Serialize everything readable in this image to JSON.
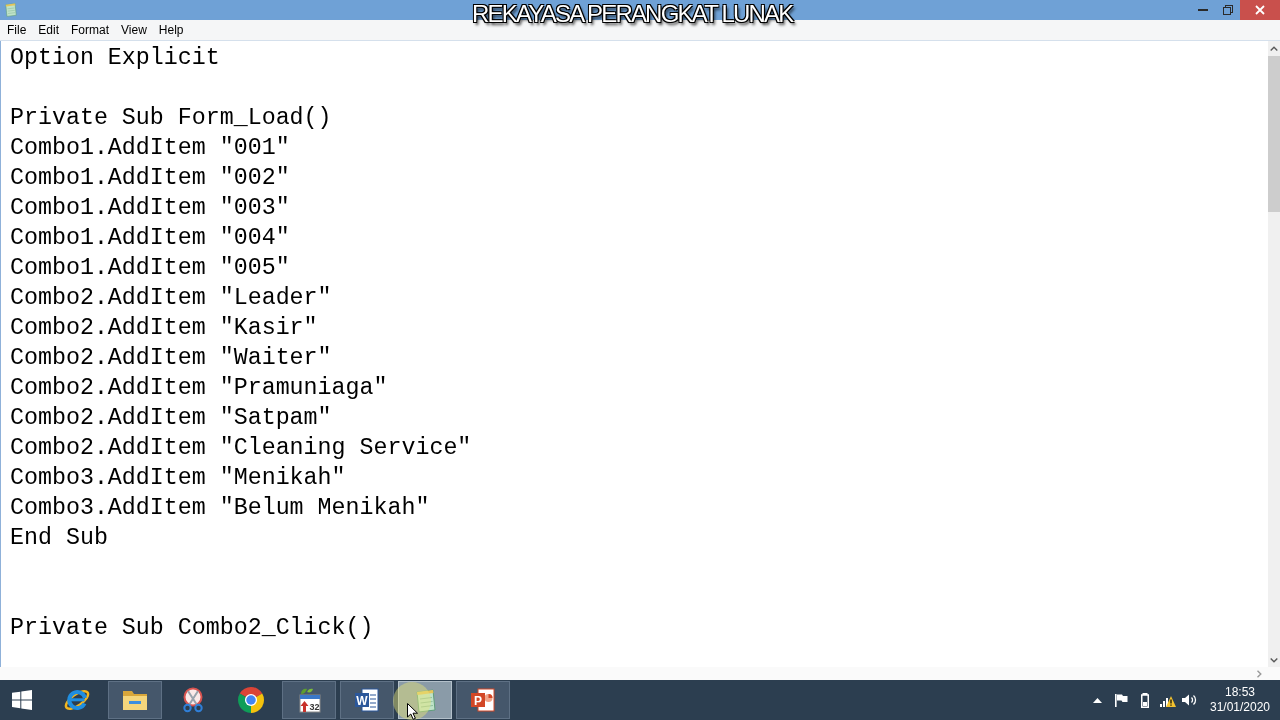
{
  "caption": "REKAYASA PERANGKAT LUNAK",
  "menu": [
    "File",
    "Edit",
    "Format",
    "View",
    "Help"
  ],
  "editor": {
    "lines": [
      {
        "kind": "code",
        "text": "Option Explicit"
      },
      {
        "kind": "blank"
      },
      {
        "kind": "code",
        "text": "Private Sub Form_Load()"
      },
      {
        "kind": "code",
        "text": "Combo1.AddItem \"001\""
      },
      {
        "kind": "code",
        "text": "Combo1.AddItem \"002\""
      },
      {
        "kind": "code",
        "text": "Combo1.AddItem \"003\""
      },
      {
        "kind": "code",
        "text": "Combo1.AddItem \"004\""
      },
      {
        "kind": "code",
        "text": "Combo1.AddItem \"005\""
      },
      {
        "kind": "code",
        "text": "Combo2.AddItem \"Leader\""
      },
      {
        "kind": "code",
        "text": "Combo2.AddItem \"Kasir\""
      },
      {
        "kind": "code",
        "text": "Combo2.AddItem \"Waiter\""
      },
      {
        "kind": "code",
        "text": "Combo2.AddItem \"Pramuniaga\""
      },
      {
        "kind": "code",
        "text": "Combo2.AddItem \"Satpam\""
      },
      {
        "kind": "code",
        "text": "Combo2.AddItem \"Cleaning Service\""
      },
      {
        "kind": "code",
        "text": "Combo3.AddItem \"Menikah\""
      },
      {
        "kind": "code",
        "text": "Combo3.AddItem \"Belum Menikah\""
      },
      {
        "kind": "code",
        "text": "End Sub"
      },
      {
        "kind": "blank"
      },
      {
        "kind": "blank"
      },
      {
        "kind": "code",
        "text": "Private Sub Combo2_Click()"
      }
    ]
  },
  "taskbar": {
    "buttons": [
      {
        "kind": "start",
        "running": false,
        "selected": false
      },
      {
        "kind": "orbit",
        "running": false,
        "selected": false
      },
      {
        "kind": "folder",
        "running": true,
        "selected": false
      },
      {
        "kind": "scissors",
        "running": false,
        "selected": false
      },
      {
        "kind": "sphere",
        "running": false,
        "selected": false
      },
      {
        "kind": "calendar",
        "glyph": "32",
        "running": true,
        "selected": false
      },
      {
        "kind": "document",
        "glyph": "W",
        "running": true,
        "selected": false
      },
      {
        "kind": "notepad",
        "running": true,
        "selected": true
      },
      {
        "kind": "slides",
        "glyph": "P",
        "running": true,
        "selected": false
      }
    ]
  },
  "tray": {
    "time": "18:53",
    "date": "31/01/2020"
  }
}
